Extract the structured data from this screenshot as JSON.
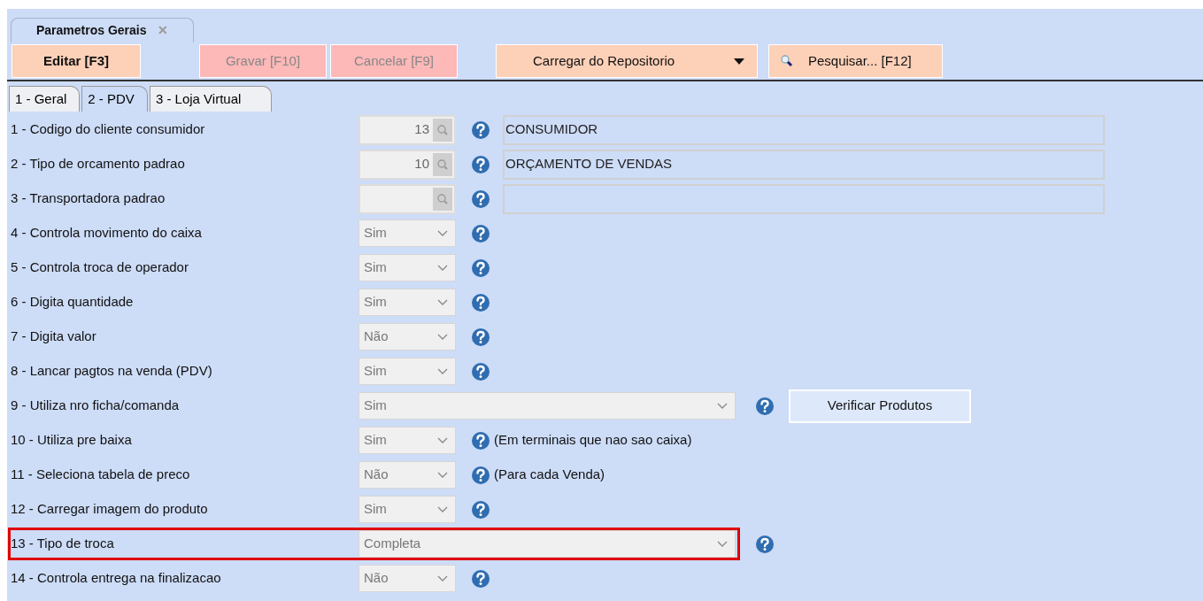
{
  "document_tab": {
    "title": "Parametros Gerais",
    "close": "✕"
  },
  "toolbar": [
    {
      "kind": "button",
      "label": "Editar [F3]",
      "disabled": false
    },
    {
      "kind": "button",
      "label": "Gravar [F10]",
      "disabled": true
    },
    {
      "kind": "button",
      "label": "Cancelar [F9]",
      "disabled": true
    },
    {
      "kind": "dropdown",
      "label": "Carregar do Repositorio",
      "disabled": false
    },
    {
      "kind": "search",
      "label": "Pesquisar... [F12]",
      "disabled": false
    }
  ],
  "tabs": [
    {
      "label": "1 - Geral",
      "selected": false
    },
    {
      "label": "2 - PDV",
      "selected": true
    },
    {
      "label": "3 - Loja Virtual",
      "selected": false
    }
  ],
  "rows": [
    {
      "kind": "lookup",
      "label": "1 - Codigo do cliente consumidor",
      "code": "13",
      "name": "CONSUMIDOR",
      "highlighted": false
    },
    {
      "kind": "lookup",
      "label": "2 - Tipo de orcamento padrao",
      "code": "10",
      "name": "ORÇAMENTO DE VENDAS",
      "highlighted": false
    },
    {
      "kind": "lookup",
      "label": "3 - Transportadora padrao",
      "highlighted": false
    },
    {
      "kind": "select",
      "label": "4 - Controla movimento do caixa",
      "value": "Sim",
      "highlighted": false
    },
    {
      "kind": "select",
      "label": "5 - Controla troca de operador",
      "value": "Sim",
      "highlighted": false
    },
    {
      "kind": "select",
      "label": "6 - Digita quantidade",
      "value": "Sim",
      "highlighted": false
    },
    {
      "kind": "select",
      "label": "7 - Digita valor",
      "value": "Não",
      "highlighted": false
    },
    {
      "kind": "select",
      "label": "8 - Lancar pagtos na venda (PDV)",
      "value": "Sim",
      "highlighted": false
    },
    {
      "kind": "wide_select",
      "label": "9 - Utiliza nro ficha/comanda",
      "value": "Sim",
      "button": "Verificar Produtos",
      "highlighted": false
    },
    {
      "kind": "select",
      "label": "10 - Utiliza pre baixa",
      "value": "Sim",
      "note": "(Em terminais que nao sao caixa)",
      "highlighted": false
    },
    {
      "kind": "select",
      "label": "11 - Seleciona tabela de preco",
      "value": "Não",
      "note": "(Para cada Venda)",
      "highlighted": false
    },
    {
      "kind": "select",
      "label": "12 - Carregar imagem do produto",
      "value": "Sim",
      "highlighted": false
    },
    {
      "kind": "wide_select",
      "label": "13 - Tipo de troca",
      "value": "Completa",
      "highlighted": true
    },
    {
      "kind": "select",
      "label": "14 - Controla entrega na finalizacao",
      "value": "Não",
      "highlighted": false
    }
  ]
}
